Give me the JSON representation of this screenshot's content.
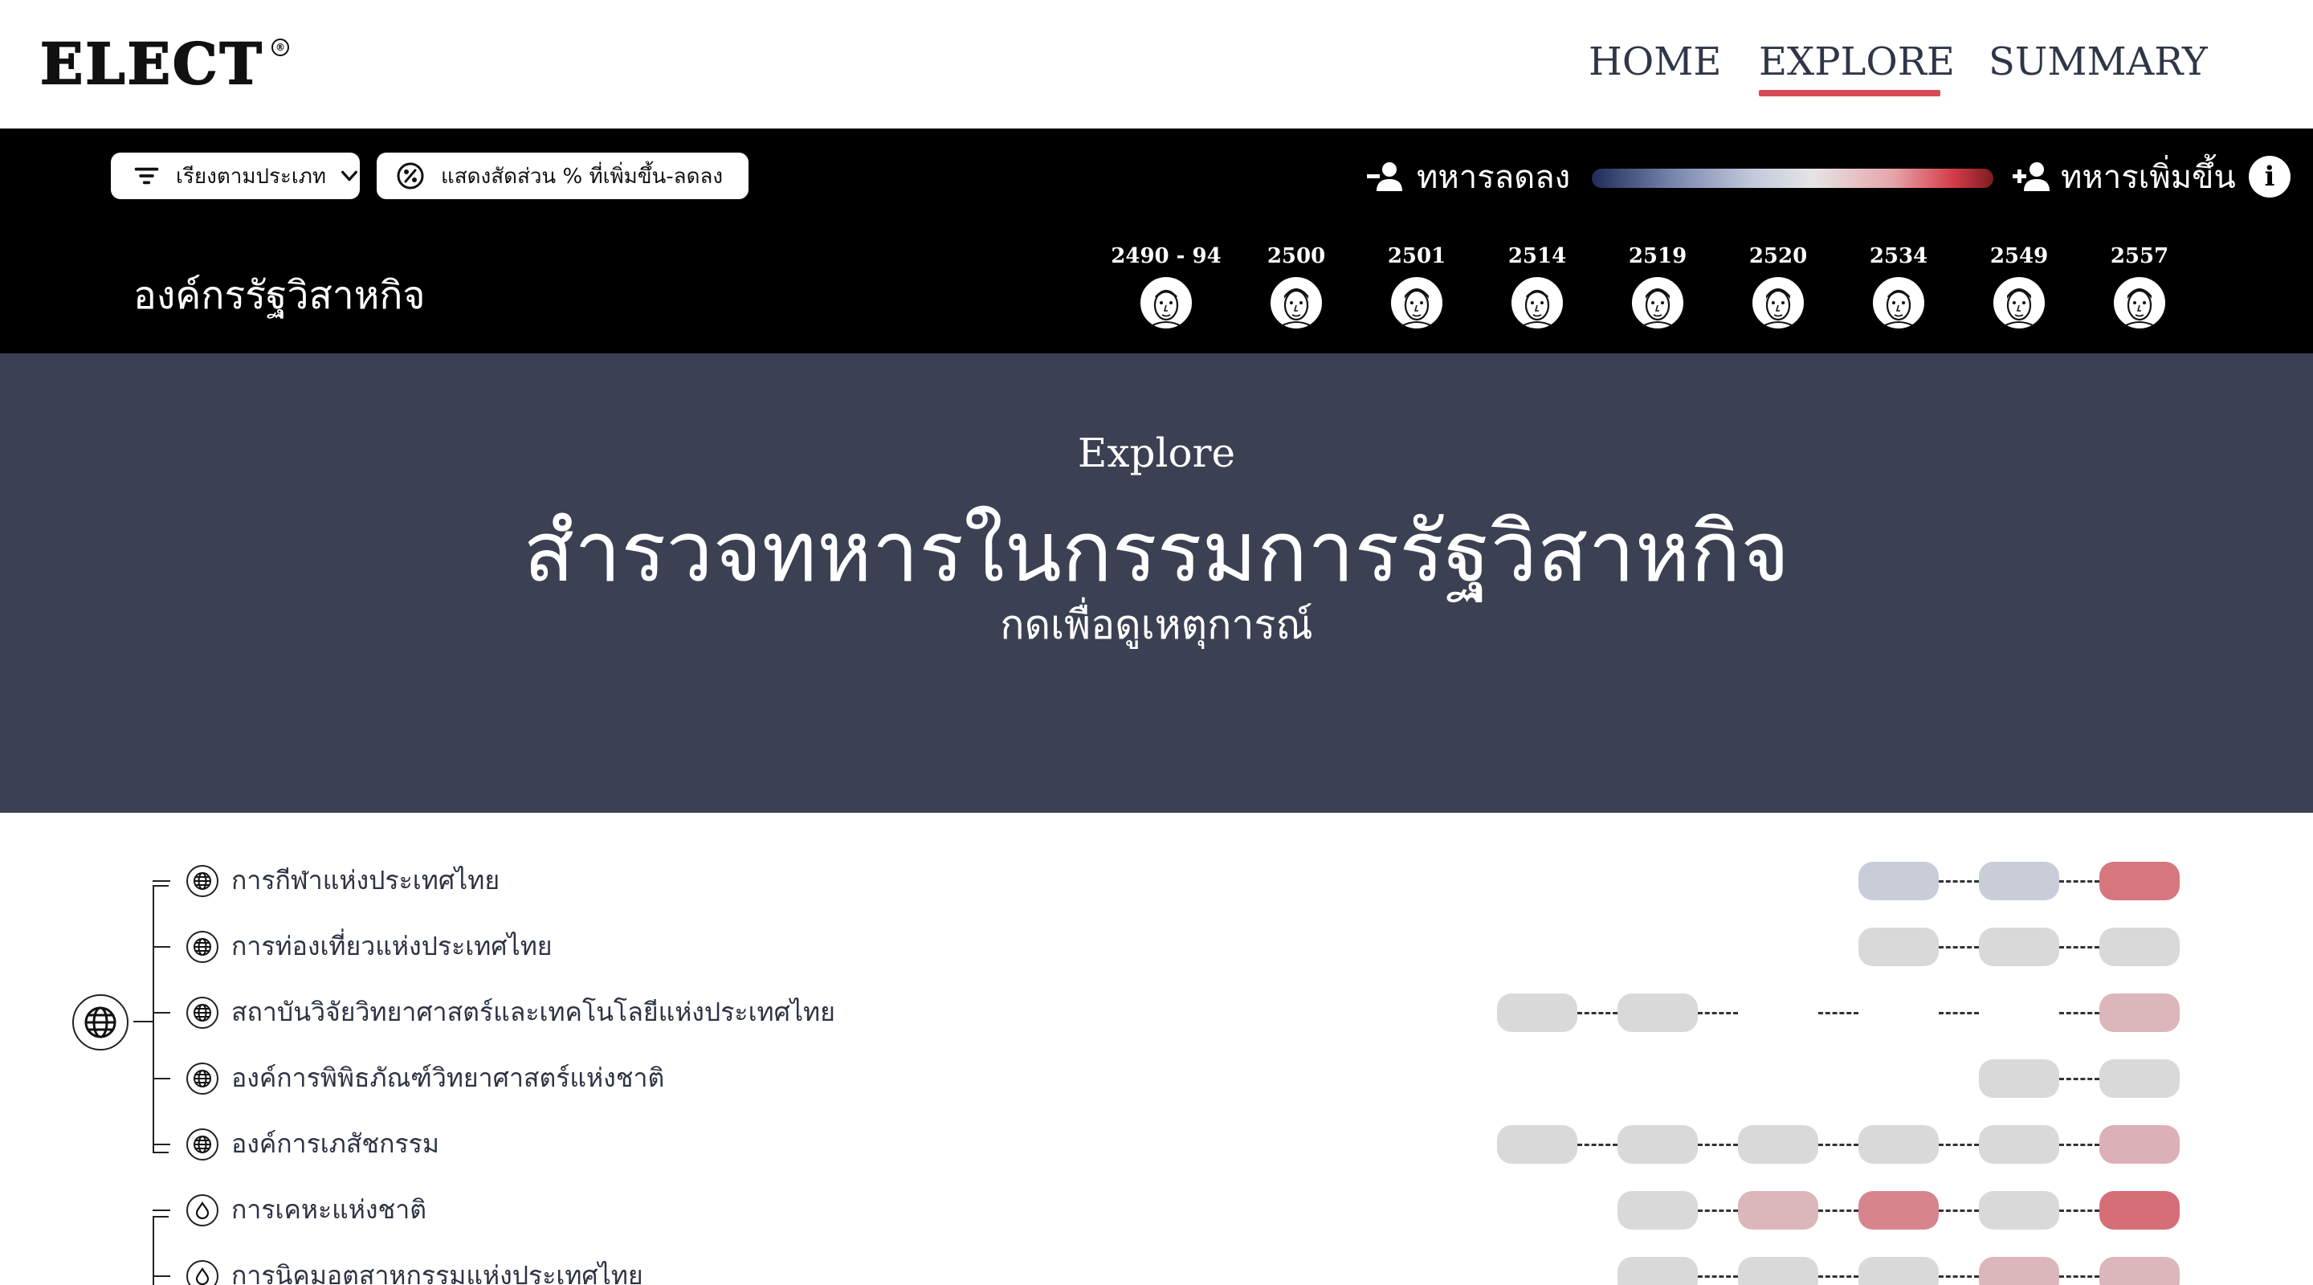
{
  "header": {
    "logo": "ELECT",
    "logo_mark": "®",
    "nav": [
      {
        "label": "HOME",
        "active": false
      },
      {
        "label": "EXPLORE",
        "active": true
      },
      {
        "label": "SUMMARY",
        "active": false
      }
    ],
    "accent_color": "#d84a55"
  },
  "controls": {
    "sort_label": "เรียงตามประเภท",
    "percent_toggle_label": "แสดงสัดส่วน % ที่เพิ่มขึ้น-ลดลง",
    "legend": {
      "decrease_label": "ทหารลดลง",
      "increase_label": "ทหารเพิ่มขึ้น",
      "low_color": "#1f2c59",
      "mid_color": "#e5e5e5",
      "high_color": "#7b1c22"
    },
    "info_label": "i"
  },
  "section": {
    "title": "องค์กรรัฐวิสาหกิจ",
    "years": [
      "2490 - 94",
      "2500",
      "2501",
      "2514",
      "2519",
      "2520",
      "2534",
      "2549",
      "2557"
    ]
  },
  "hero": {
    "kicker": "Explore",
    "title": "สำรวจทหารในกรรมการรัฐวิสาหกิจ",
    "subtitle": "กดเพื่อดูเหตุการณ์"
  },
  "groups": [
    {
      "icon": "globe-icon",
      "orgs": [
        {
          "name": "การกีฬาแห่งประเทศไทย",
          "icon": "globe-icon",
          "levels": [
            null,
            null,
            null,
            null,
            null,
            null,
            "#c9cdd8",
            "#c9cdd8",
            "#d6777f"
          ]
        },
        {
          "name": "การท่องเที่ยวแห่งประเทศไทย",
          "icon": "globe-icon",
          "levels": [
            null,
            null,
            null,
            null,
            null,
            null,
            "#d9d9d9",
            "#d9d9d9",
            "#d9d9d9"
          ]
        },
        {
          "name": "สถาบันวิจัยวิทยาศาสตร์และเทคโนโลยีแห่งประเทศไทย",
          "icon": "globe-icon",
          "levels": [
            null,
            null,
            null,
            "#d9d9d9",
            "#d9d9d9",
            "#ffffff",
            "#ffffff",
            "#ffffff",
            "#dbb6bb"
          ]
        },
        {
          "name": "องค์การพิพิธภัณฑ์วิทยาศาสตร์แห่งชาติ",
          "icon": "globe-icon",
          "levels": [
            null,
            null,
            null,
            null,
            null,
            null,
            null,
            "#d9d9d9",
            "#d9d9d9"
          ]
        },
        {
          "name": "องค์การเภสัชกรรม",
          "icon": "globe-icon",
          "levels": [
            null,
            null,
            null,
            "#d9d9d9",
            "#d9d9d9",
            "#d9d9d9",
            "#d9d9d9",
            "#d9d9d9",
            "#dbb0b6"
          ]
        }
      ]
    },
    {
      "icon": "drop-icon",
      "orgs": [
        {
          "name": "การเคหะแห่งชาติ",
          "icon": "drop-icon",
          "levels": [
            null,
            null,
            null,
            null,
            "#d9d9d9",
            "#dbb6bb",
            "#d6858c",
            "#d9d9d9",
            "#d66e77"
          ]
        },
        {
          "name": "การนิคมอุตสาหกรรมแห่งประเทศไทย",
          "icon": "drop-icon",
          "levels": [
            null,
            null,
            null,
            null,
            "#d9d9d9",
            "#d9d9d9",
            "#d9d9d9",
            "#dbb6bb",
            "#dbb6bb"
          ]
        }
      ]
    }
  ]
}
